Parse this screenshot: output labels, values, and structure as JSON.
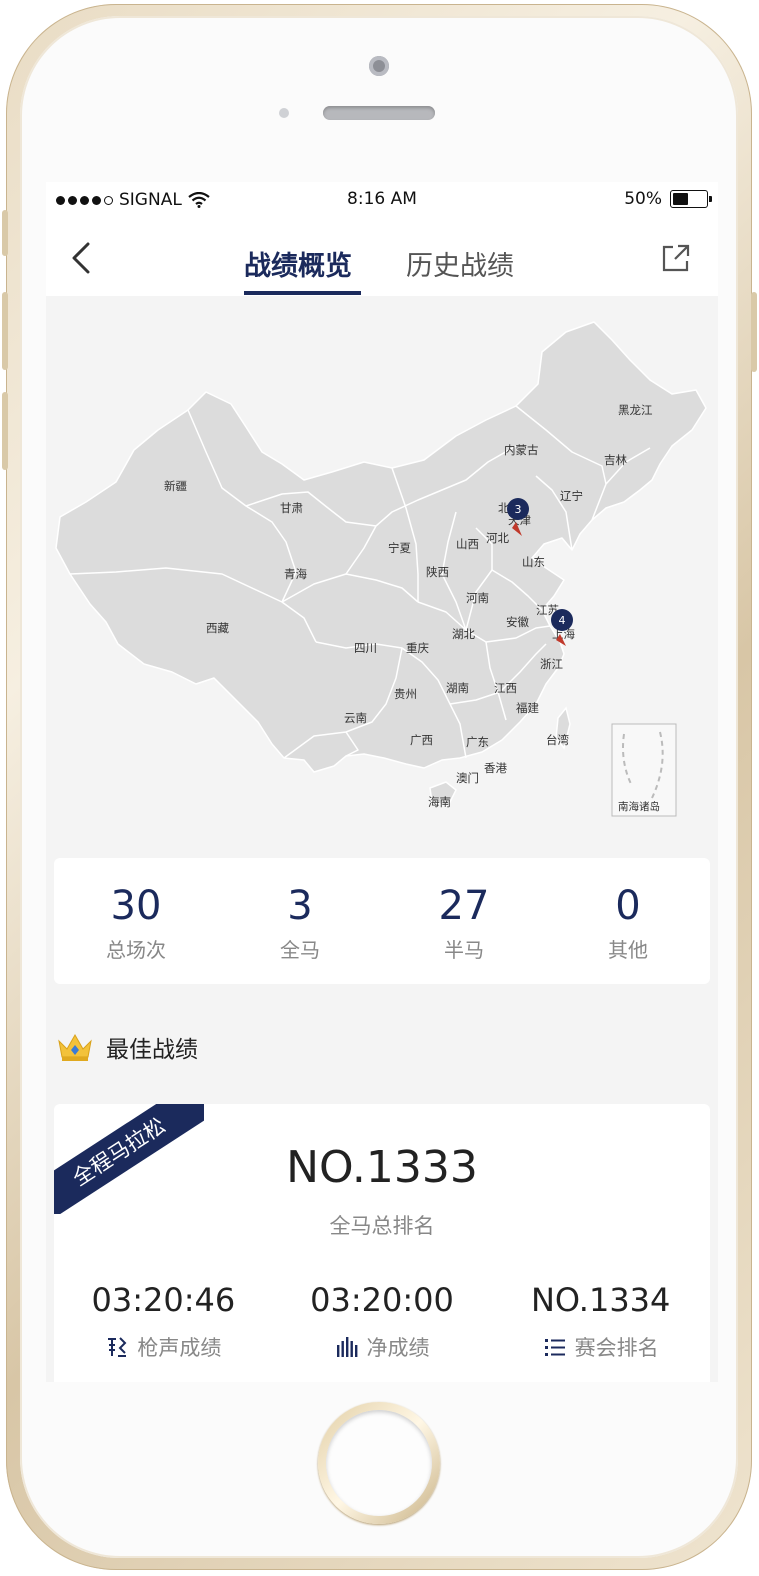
{
  "status": {
    "carrier": "SIGNAL",
    "time": "8:16 AM",
    "battery": "50%",
    "battery_level": 0.5
  },
  "nav": {
    "tabs": [
      {
        "label": "战绩概览",
        "active": true
      },
      {
        "label": "历史战绩",
        "active": false
      }
    ]
  },
  "map": {
    "provinces": {
      "heilongjiang": "黑龙江",
      "jilin": "吉林",
      "liaoning": "辽宁",
      "neimenggu": "内蒙古",
      "xinjiang": "新疆",
      "gansu": "甘肃",
      "ningxia": "宁夏",
      "beijing": "北京",
      "tianjin": "天津",
      "shanxi": "山西",
      "hebei": "河北",
      "shandong": "山东",
      "qinghai": "青海",
      "shaanxi": "陕西",
      "henan": "河南",
      "jiangsu": "江苏",
      "anhui": "安徽",
      "shanghai": "上海",
      "xizang": "西藏",
      "sichuan": "四川",
      "chongqing": "重庆",
      "hubei": "湖北",
      "zhejiang": "浙江",
      "guizhou": "贵州",
      "hunan": "湖南",
      "jiangxi": "江西",
      "fujian": "福建",
      "yunnan": "云南",
      "guangxi": "广西",
      "guangdong": "广东",
      "taiwan": "台湾",
      "xianggang": "香港",
      "aomen": "澳门",
      "hainan": "海南",
      "nanhai": "南海诸岛"
    },
    "markers": [
      {
        "label": "3",
        "city": "天津"
      },
      {
        "label": "4",
        "city": "上海"
      }
    ],
    "fill_color": "#dddddd",
    "marker_color": "#1b2a5c",
    "pin_color": "#c0392b"
  },
  "stats": [
    {
      "value": "30",
      "label": "总场次"
    },
    {
      "value": "3",
      "label": "全马"
    },
    {
      "value": "27",
      "label": "半马"
    },
    {
      "value": "0",
      "label": "其他"
    }
  ],
  "best": {
    "title": "最佳战绩",
    "ribbon": "全程马拉松",
    "rank": "NO.1333",
    "rank_label": "全马总排名",
    "metrics": [
      {
        "value": "03:20:46",
        "label": "枪声成绩",
        "icon": "gun-time-icon"
      },
      {
        "value": "03:20:00",
        "label": "净成绩",
        "icon": "bars-icon"
      },
      {
        "value": "NO.1334",
        "label": "赛会排名",
        "icon": "list-icon"
      }
    ]
  },
  "colors": {
    "accent": "#1b2a5c",
    "background": "#f4f4f4"
  }
}
